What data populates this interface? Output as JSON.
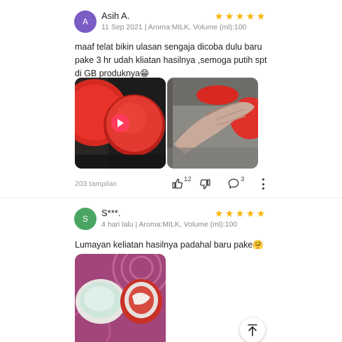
{
  "reviews": [
    {
      "avatar_letter": "A",
      "avatar_color": "#7b5bc4",
      "name": "Asih A.",
      "meta": "11 Sep 2021 | Aroma:MILK, Volume (ml):100",
      "rating": 5,
      "text": "maaf telat bikin ulasan sengaja dicoba dulu baru pake 3 hr udah kliatan hasilnya ,semoga putih spt di GB produknya😁",
      "media": [
        "video-thumbnail-red-jar",
        "photo-hand-with-red-jar"
      ],
      "views": "203 tampilan",
      "likes": "12",
      "comments": "3"
    },
    {
      "avatar_letter": "S",
      "avatar_color": "#4aa564",
      "name": "S***.",
      "meta": "4  hari lalu | Aroma:MILK, Volume (ml):100",
      "rating": 5,
      "text": "Lumayan keliatan hasilnya padahal baru pake🤗",
      "media": [
        "photo-open-cream-jars"
      ]
    }
  ],
  "colors": {
    "star": "#f7b500",
    "jar_red": "#e8322a"
  },
  "icons": [
    "thumbs-up-icon",
    "thumbs-down-icon",
    "comment-icon",
    "more-vert-icon",
    "play-icon",
    "arrow-up-icon"
  ]
}
